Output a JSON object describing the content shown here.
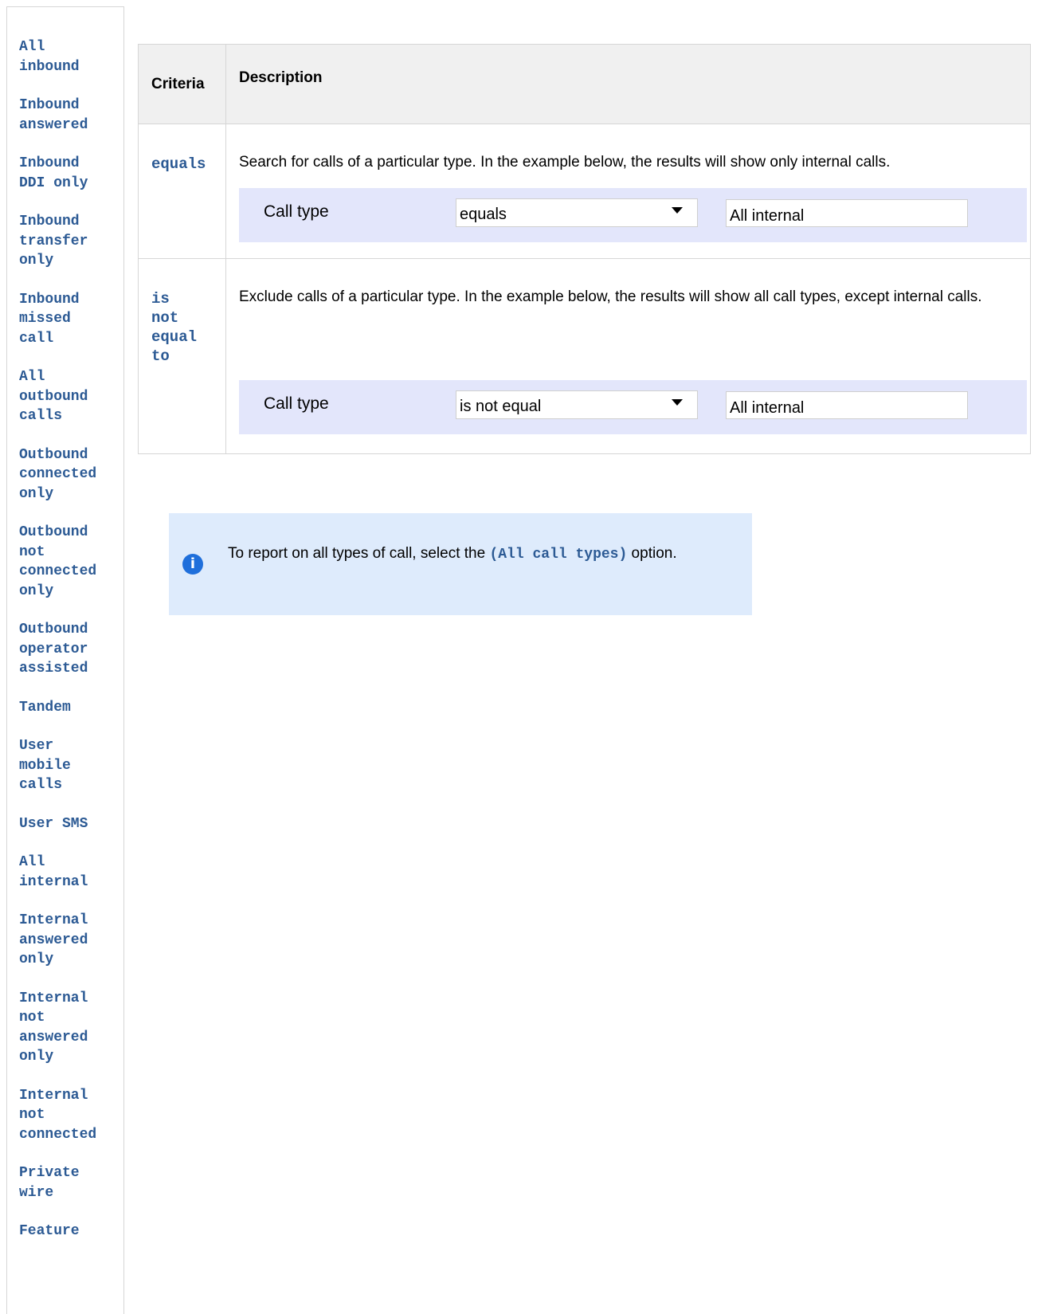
{
  "sidebar": {
    "items": [
      {
        "label": "All\ninbound"
      },
      {
        "label": "Inbound\nanswered"
      },
      {
        "label": "Inbound\nDDI only"
      },
      {
        "label": "Inbound\ntransfer\nonly"
      },
      {
        "label": "Inbound\nmissed\ncall"
      },
      {
        "label": "All\noutbound\ncalls"
      },
      {
        "label": "Outbound\nconnected\nonly"
      },
      {
        "label": "Outbound\nnot\nconnected\nonly"
      },
      {
        "label": "Outbound\noperator\nassisted"
      },
      {
        "label": "Tandem"
      },
      {
        "label": "User\nmobile\ncalls"
      },
      {
        "label": "User SMS"
      },
      {
        "label": "All\ninternal"
      },
      {
        "label": "Internal\nanswered\nonly"
      },
      {
        "label": "Internal\nnot\nanswered\nonly"
      },
      {
        "label": "Internal\nnot\nconnected"
      },
      {
        "label": "Private\nwire"
      },
      {
        "label": "Feature"
      }
    ]
  },
  "table": {
    "headers": {
      "criteria": "Criteria",
      "description": "Description"
    },
    "rows": [
      {
        "criteria": "equals",
        "description": "Search for calls of a particular type. In the example below, the results will show only internal calls.",
        "example": {
          "label": "Call type",
          "operator": "equals",
          "value": "All internal"
        }
      },
      {
        "criteria": "is\nnot\nequal\nto",
        "description": "Exclude calls of a particular type. In the example below, the results will show all call types, except internal calls.",
        "example": {
          "label": "Call type",
          "operator": "is not equal",
          "value": "All internal"
        }
      }
    ]
  },
  "info": {
    "icon": "info-icon",
    "text_before": "To report on all types of call, select the ",
    "code": "(All call types)",
    "text_after": " option."
  },
  "colors": {
    "link": "#2c5a94",
    "example_bg": "#e3e6fb",
    "info_bg": "#deebfc",
    "info_icon": "#1f6fdb"
  }
}
